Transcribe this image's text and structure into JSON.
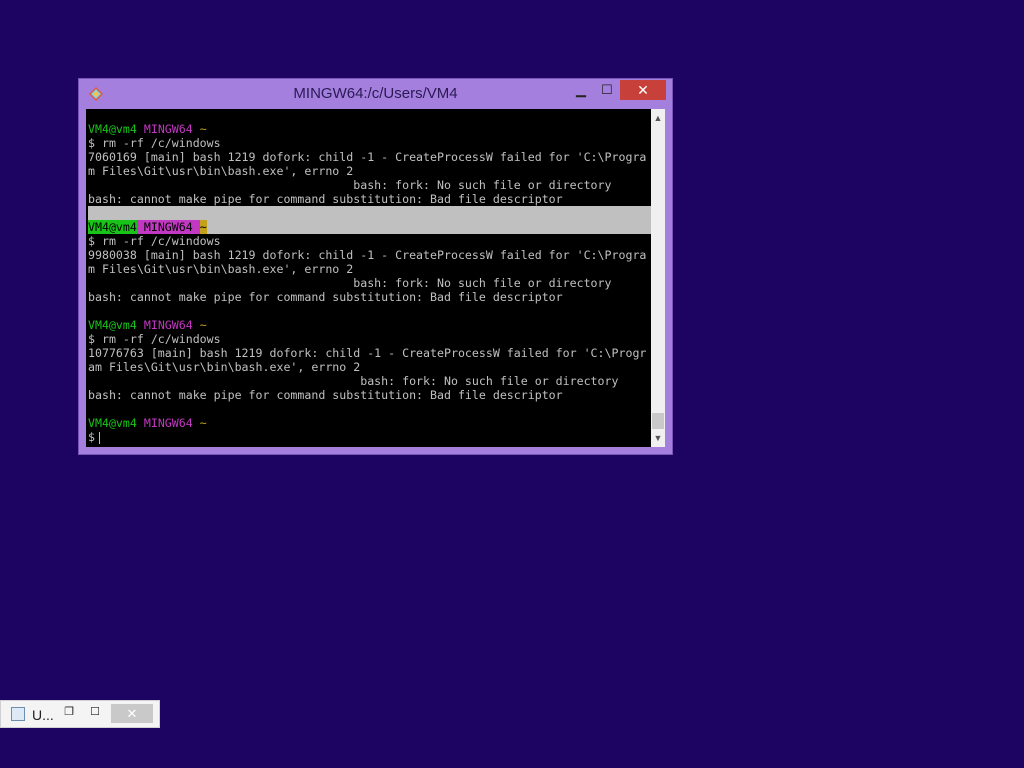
{
  "window": {
    "title": "MINGW64:/c/Users/VM4",
    "minimize_glyph": "▁",
    "maximize_glyph": "☐",
    "close_glyph": "✕"
  },
  "terminal": {
    "lines": [
      {
        "type": "prompt",
        "user": "VM4@vm4",
        "sys": "MINGW64",
        "dir": "~"
      },
      {
        "type": "text",
        "text": "$ rm -rf /c/windows"
      },
      {
        "type": "text",
        "text": "7060169 [main] bash 1219 dofork: child -1 - CreateProcessW failed for 'C:\\Progra"
      },
      {
        "type": "text",
        "text": "m Files\\Git\\usr\\bin\\bash.exe', errno 2"
      },
      {
        "type": "text",
        "text": "                                      bash: fork: No such file or directory"
      },
      {
        "type": "text",
        "text": "bash: cannot make pipe for command substitution: Bad file descriptor"
      },
      {
        "type": "blank",
        "highlight": true
      },
      {
        "type": "prompt",
        "user": "VM4@vm4",
        "sys": "MINGW64",
        "dir": "~",
        "highlight": true
      },
      {
        "type": "text",
        "text": "$ rm -rf /c/windows"
      },
      {
        "type": "text",
        "text": "9980038 [main] bash 1219 dofork: child -1 - CreateProcessW failed for 'C:\\Progra"
      },
      {
        "type": "text",
        "text": "m Files\\Git\\usr\\bin\\bash.exe', errno 2"
      },
      {
        "type": "text",
        "text": "                                      bash: fork: No such file or directory"
      },
      {
        "type": "text",
        "text": "bash: cannot make pipe for command substitution: Bad file descriptor"
      },
      {
        "type": "blank"
      },
      {
        "type": "prompt",
        "user": "VM4@vm4",
        "sys": "MINGW64",
        "dir": "~"
      },
      {
        "type": "text",
        "text": "$ rm -rf /c/windows"
      },
      {
        "type": "text",
        "text": "10776763 [main] bash 1219 dofork: child -1 - CreateProcessW failed for 'C:\\Progr"
      },
      {
        "type": "text",
        "text": "am Files\\Git\\usr\\bin\\bash.exe', errno 2"
      },
      {
        "type": "text",
        "text": "                                       bash: fork: No such file or directory"
      },
      {
        "type": "text",
        "text": "bash: cannot make pipe for command substitution: Bad file descriptor"
      },
      {
        "type": "blank"
      },
      {
        "type": "prompt",
        "user": "VM4@vm4",
        "sys": "MINGW64",
        "dir": "~"
      },
      {
        "type": "input",
        "text": "$"
      }
    ]
  },
  "scrollbar": {
    "up_glyph": "▲",
    "down_glyph": "▼"
  },
  "minimized_window": {
    "label": "U...",
    "restore_glyph": "❐",
    "maximize_glyph": "☐",
    "close_glyph": "✕"
  },
  "colors": {
    "desktop": "#1d0463",
    "window_frame": "#a47fdd",
    "close_button": "#c8403a",
    "prompt_user": "#19c419",
    "prompt_sys": "#c238c2",
    "prompt_dir": "#c2a019"
  }
}
